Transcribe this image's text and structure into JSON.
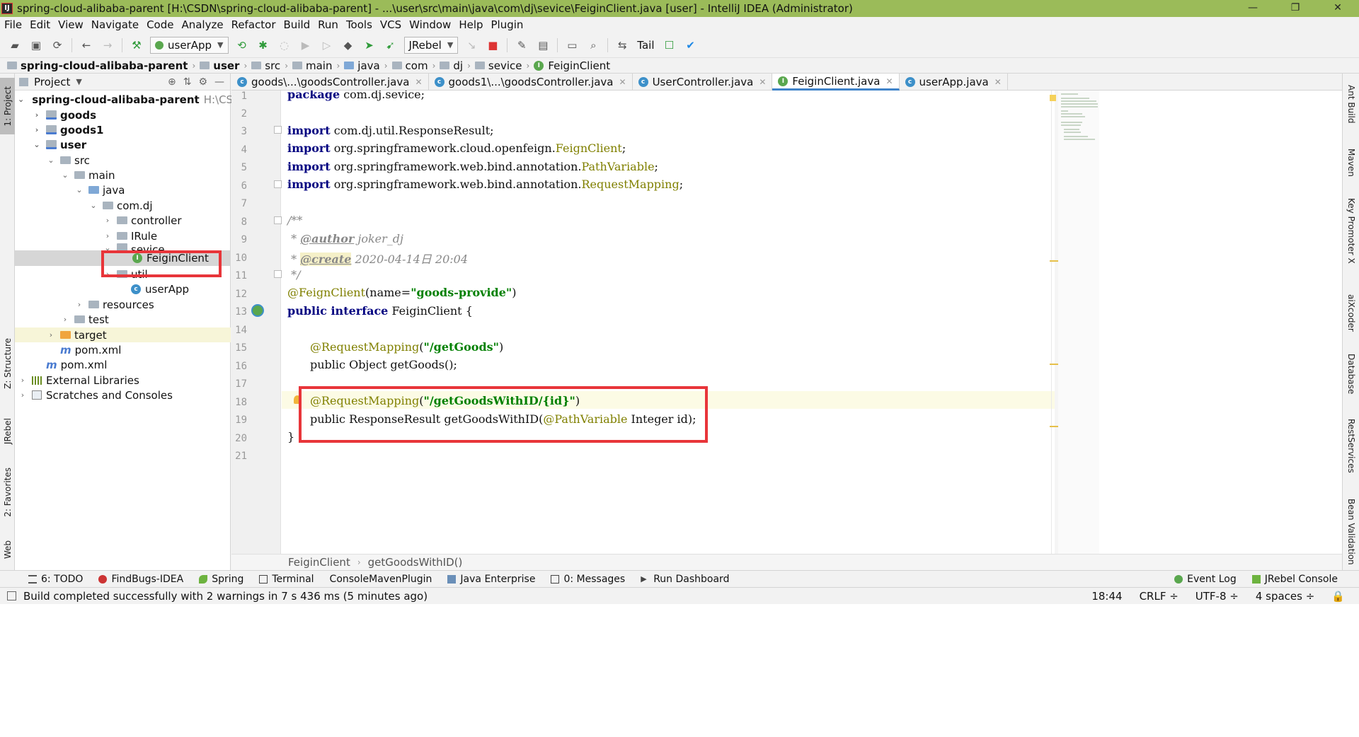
{
  "window": {
    "title": "spring-cloud-alibaba-parent [H:\\CSDN\\spring-cloud-alibaba-parent] - ...\\user\\src\\main\\java\\com\\dj\\sevice\\FeiginClient.java [user] - IntelliJ IDEA (Administrator)",
    "minimize": "—",
    "maximize": "❐",
    "close": "✕"
  },
  "menu": [
    "File",
    "Edit",
    "View",
    "Navigate",
    "Code",
    "Analyze",
    "Refactor",
    "Build",
    "Run",
    "Tools",
    "VCS",
    "Window",
    "Help",
    "Plugin"
  ],
  "toolbar": {
    "run_config": "userApp",
    "jrebel": "JRebel",
    "tail": "Tail"
  },
  "navbar": {
    "crumbs": [
      "spring-cloud-alibaba-parent",
      "user",
      "src",
      "main",
      "java",
      "com",
      "dj",
      "sevice",
      "FeiginClient"
    ]
  },
  "left_tools": {
    "project": "1: Project",
    "structure": "Z: Structure",
    "jrebel": "JRebel",
    "favorites": "2: Favorites",
    "web": "Web"
  },
  "right_tools": {
    "ant": "Ant Build",
    "maven": "Maven",
    "key_promoter": "Key Promoter X",
    "aixcoder": "aiXcoder",
    "database": "Database",
    "rest": "RestServices",
    "bean": "Bean Validation"
  },
  "project_panel": {
    "title": "Project",
    "tree": [
      {
        "label": "spring-cloud-alibaba-parent",
        "path": "H:\\CSDN\\spri",
        "bold": true
      },
      {
        "label": "goods",
        "bold": true
      },
      {
        "label": "goods1",
        "bold": true
      },
      {
        "label": "user",
        "bold": true
      },
      {
        "label": "src"
      },
      {
        "label": "main"
      },
      {
        "label": "java"
      },
      {
        "label": "com.dj"
      },
      {
        "label": "controller"
      },
      {
        "label": "IRule"
      },
      {
        "label": "sevice"
      },
      {
        "label": "FeiginClient"
      },
      {
        "label": "util"
      },
      {
        "label": "userApp"
      },
      {
        "label": "resources"
      },
      {
        "label": "test"
      },
      {
        "label": "target"
      },
      {
        "label": "pom.xml"
      },
      {
        "label": "pom.xml"
      },
      {
        "label": "External Libraries"
      },
      {
        "label": "Scratches and Consoles"
      }
    ]
  },
  "tabs": [
    {
      "label": "goods\\...\\goodsController.java"
    },
    {
      "label": "goods1\\...\\goodsController.java"
    },
    {
      "label": "UserController.java"
    },
    {
      "label": "FeiginClient.java"
    },
    {
      "label": "userApp.java"
    }
  ],
  "editor": {
    "line_numbers": [
      "1",
      "2",
      "3",
      "4",
      "5",
      "6",
      "7",
      "8",
      "9",
      "10",
      "11",
      "12",
      "13",
      "14",
      "15",
      "16",
      "17",
      "18",
      "19",
      "20",
      "21"
    ],
    "line1": {
      "kw": "package",
      "rest": " com.dj.sevice;"
    },
    "line3": {
      "kw": "import",
      "rest": " com.dj.util.ResponseResult;"
    },
    "line4": {
      "kw": "import",
      "rest": " org.springframework.cloud.openfeign.",
      "ann": "FeignClient",
      "end": ";"
    },
    "line5": {
      "kw": "import",
      "rest": " org.springframework.web.bind.annotation.",
      "ann": "PathVariable",
      "end": ";"
    },
    "line6": {
      "kw": "import",
      "rest": " org.springframework.web.bind.annotation.",
      "ann": "RequestMapping",
      "end": ";"
    },
    "line8": "/**",
    "line9": {
      "pre": " * ",
      "tag": "@author",
      "text": " joker_dj"
    },
    "line10": {
      "pre": " * ",
      "tag": "@create",
      "text": " 2020-04-14日 20:04"
    },
    "line11": " */",
    "line12": {
      "ann": "@FeignClient",
      "mid": "(name=",
      "str": "\"goods-provide\"",
      "end": ")"
    },
    "line13": {
      "kw": "public interface",
      "rest": " FeiginClient {"
    },
    "line15": {
      "ann": "@RequestMapping",
      "mid": "(",
      "str": "\"/getGoods\"",
      "end": ")"
    },
    "line16": "public Object getGoods();",
    "line18": {
      "ann": "@RequestMapping",
      "mid": "(",
      "str": "\"/getGoodsWithID/{id}\"",
      "end": ")"
    },
    "line19": {
      "pre": "public ResponseResult getGoodsWithID(",
      "ann": "@PathVariable",
      "end": " Integer id);"
    },
    "line20": "}"
  },
  "editor_breadcrumb": [
    "FeiginClient",
    "getGoodsWithID()"
  ],
  "bottom_tools": {
    "left": [
      "6: TODO",
      "FindBugs-IDEA",
      "Spring",
      "Terminal",
      "ConsoleMavenPlugin",
      "Java Enterprise",
      "0: Messages",
      "Run Dashboard"
    ],
    "right": [
      "Event Log",
      "JRebel Console"
    ]
  },
  "status": {
    "message": "Build completed successfully with 2 warnings in 7 s 436 ms (5 minutes ago)",
    "position": "18:44",
    "line_sep": "CRLF ÷",
    "encoding": "UTF-8 ÷",
    "indent": "4 spaces ÷"
  },
  "colors": {
    "titlebar": "#9bbb59",
    "highlight_box": "#e8353a",
    "active_tab": "#4083c9"
  }
}
